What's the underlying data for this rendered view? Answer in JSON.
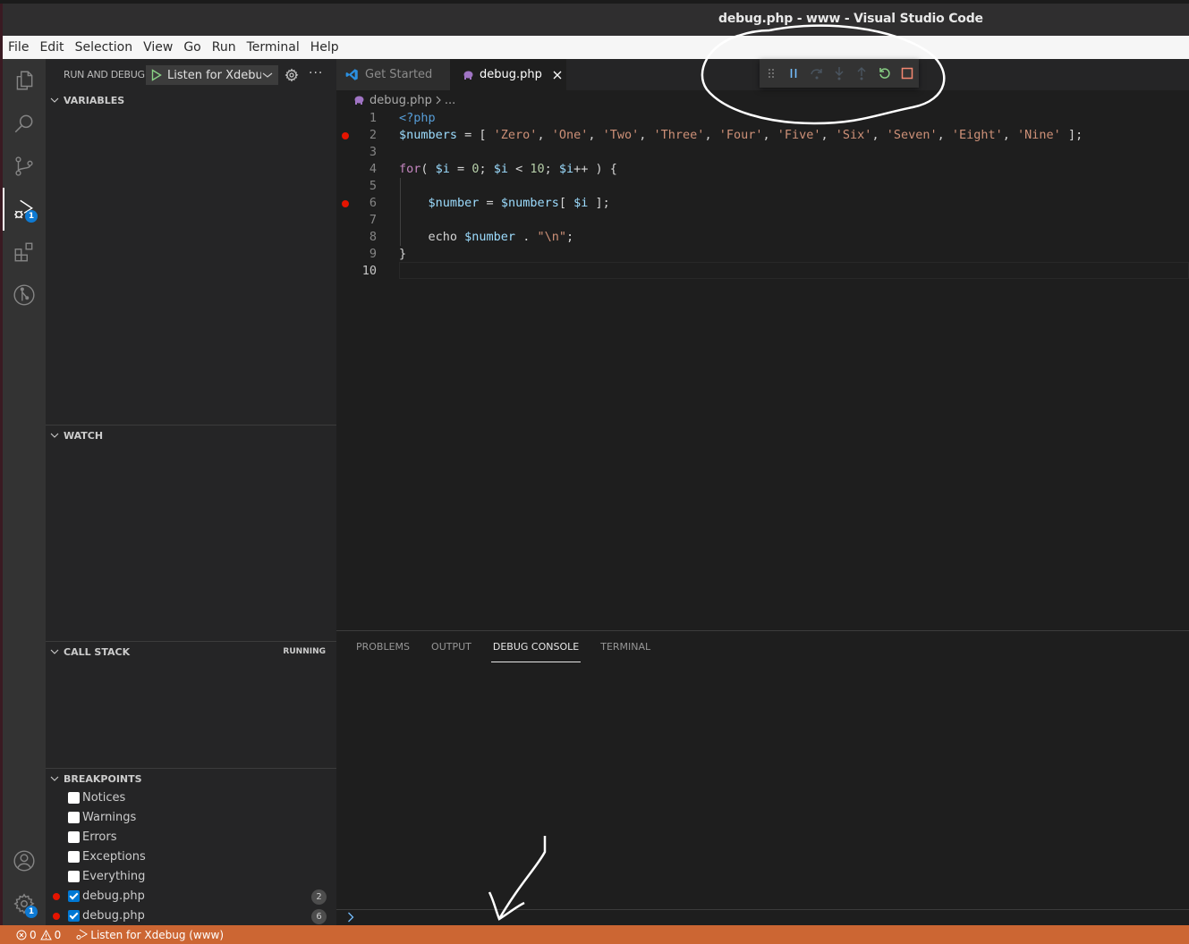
{
  "window": {
    "title": "debug.php - www - Visual Studio Code"
  },
  "menubar": {
    "items": [
      "File",
      "Edit",
      "Selection",
      "View",
      "Go",
      "Run",
      "Terminal",
      "Help"
    ]
  },
  "activitybar": {
    "items": [
      {
        "icon": "files-icon",
        "label": "Explorer"
      },
      {
        "icon": "search-icon",
        "label": "Search"
      },
      {
        "icon": "source-control-icon",
        "label": "Source Control"
      },
      {
        "icon": "run-debug-icon",
        "label": "Run and Debug",
        "badge": "1",
        "active": true
      },
      {
        "icon": "extensions-icon",
        "label": "Extensions"
      },
      {
        "icon": "git-graph-icon",
        "label": "Git Graph"
      }
    ],
    "bottom": [
      {
        "icon": "account-icon",
        "label": "Accounts"
      },
      {
        "icon": "manage-gear-icon",
        "label": "Manage",
        "badge": "1"
      }
    ]
  },
  "sidebar": {
    "title": "RUN AND DEBUG",
    "launch_config": "Listen for Xdebug",
    "sections": {
      "variables": {
        "title": "VARIABLES"
      },
      "watch": {
        "title": "WATCH"
      },
      "call_stack": {
        "title": "CALL STACK",
        "status": "RUNNING"
      },
      "breakpoints": {
        "title": "BREAKPOINTS",
        "items": [
          {
            "label": "Notices",
            "checked": false
          },
          {
            "label": "Warnings",
            "checked": false
          },
          {
            "label": "Errors",
            "checked": false
          },
          {
            "label": "Exceptions",
            "checked": false
          },
          {
            "label": "Everything",
            "checked": false
          },
          {
            "label": "debug.php",
            "checked": true,
            "line": "2",
            "dot": true
          },
          {
            "label": "debug.php",
            "checked": true,
            "line": "6",
            "dot": true
          }
        ]
      }
    }
  },
  "tabs": [
    {
      "label": "Get Started",
      "icon": "vscode-logo-icon",
      "active": false
    },
    {
      "label": "debug.php",
      "icon": "php-elephant-icon",
      "active": true,
      "closable": true
    }
  ],
  "debug_toolbar": {
    "buttons": [
      {
        "name": "drag-handle",
        "enabled": true
      },
      {
        "name": "pause",
        "enabled": true
      },
      {
        "name": "step-over",
        "enabled": false
      },
      {
        "name": "step-into",
        "enabled": false
      },
      {
        "name": "step-out",
        "enabled": false
      },
      {
        "name": "restart",
        "enabled": true
      },
      {
        "name": "stop",
        "enabled": true
      }
    ]
  },
  "breadcrumb": {
    "file": "debug.php",
    "rest": "..."
  },
  "editor": {
    "current_line": 10,
    "breakpoint_lines": [
      2,
      6
    ],
    "lines": [
      {
        "n": "1",
        "tokens": [
          [
            "kw",
            "<?php"
          ]
        ]
      },
      {
        "n": "2",
        "tokens": [
          [
            "var",
            "$numbers"
          ],
          [
            "punc",
            " = [ "
          ],
          [
            "str",
            "'Zero'"
          ],
          [
            "punc",
            ", "
          ],
          [
            "str",
            "'One'"
          ],
          [
            "punc",
            ", "
          ],
          [
            "str",
            "'Two'"
          ],
          [
            "punc",
            ", "
          ],
          [
            "str",
            "'Three'"
          ],
          [
            "punc",
            ", "
          ],
          [
            "str",
            "'Four'"
          ],
          [
            "punc",
            ", "
          ],
          [
            "str",
            "'Five'"
          ],
          [
            "punc",
            ", "
          ],
          [
            "str",
            "'Six'"
          ],
          [
            "punc",
            ", "
          ],
          [
            "str",
            "'Seven'"
          ],
          [
            "punc",
            ", "
          ],
          [
            "str",
            "'Eight'"
          ],
          [
            "punc",
            ", "
          ],
          [
            "str",
            "'Nine'"
          ],
          [
            "punc",
            " ];"
          ]
        ]
      },
      {
        "n": "3",
        "tokens": []
      },
      {
        "n": "4",
        "tokens": [
          [
            "ctl",
            "for"
          ],
          [
            "punc",
            "( "
          ],
          [
            "var",
            "$i"
          ],
          [
            "punc",
            " = "
          ],
          [
            "num",
            "0"
          ],
          [
            "punc",
            "; "
          ],
          [
            "var",
            "$i"
          ],
          [
            "punc",
            " < "
          ],
          [
            "num",
            "10"
          ],
          [
            "punc",
            "; "
          ],
          [
            "var",
            "$i"
          ],
          [
            "punc",
            "++ ) {"
          ]
        ]
      },
      {
        "n": "5",
        "tokens": []
      },
      {
        "n": "6",
        "tokens": [
          [
            "punc",
            "    "
          ],
          [
            "var",
            "$number"
          ],
          [
            "punc",
            " = "
          ],
          [
            "var",
            "$numbers"
          ],
          [
            "punc",
            "[ "
          ],
          [
            "var",
            "$i"
          ],
          [
            "punc",
            " ];"
          ]
        ]
      },
      {
        "n": "7",
        "tokens": []
      },
      {
        "n": "8",
        "tokens": [
          [
            "punc",
            "    echo "
          ],
          [
            "var",
            "$number"
          ],
          [
            "punc",
            " . "
          ],
          [
            "str",
            "\"\\n\""
          ],
          [
            "punc",
            ";"
          ]
        ]
      },
      {
        "n": "9",
        "tokens": [
          [
            "punc",
            "}"
          ]
        ]
      },
      {
        "n": "10",
        "tokens": []
      }
    ]
  },
  "panel": {
    "tabs": [
      {
        "label": "PROBLEMS",
        "active": false
      },
      {
        "label": "OUTPUT",
        "active": false
      },
      {
        "label": "DEBUG CONSOLE",
        "active": true
      },
      {
        "label": "TERMINAL",
        "active": false
      }
    ]
  },
  "statusbar": {
    "errors": "0",
    "warnings": "0",
    "debug_target": "Listen for Xdebug (www)",
    "color": "#cc6633"
  },
  "colors": {
    "breakpoint": "#e51400",
    "badge": "#0e7ad3",
    "restart": "#89d185",
    "stop": "#f48771",
    "pause": "#75beff"
  }
}
